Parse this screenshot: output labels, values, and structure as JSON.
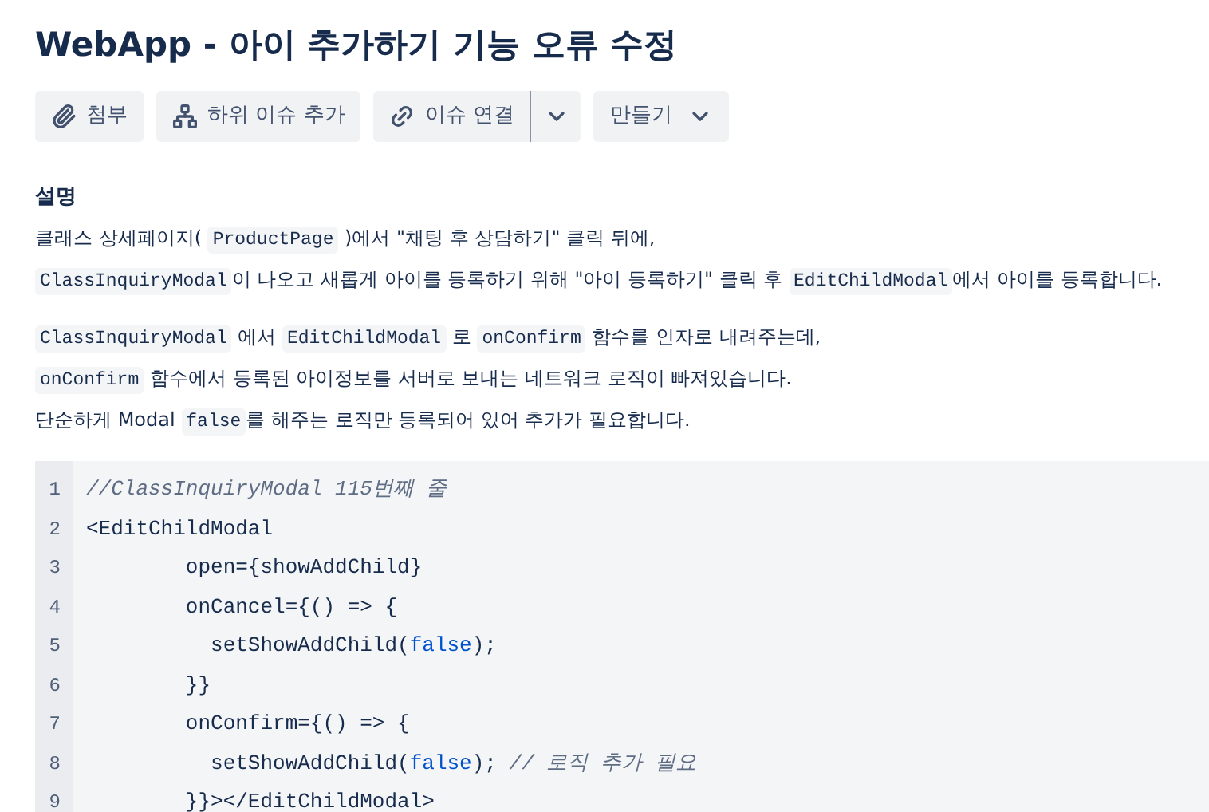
{
  "title": "WebApp - 아이 추가하기 기능 오류 수정",
  "toolbar": [
    {
      "kind": "attach",
      "label": "첨부"
    },
    {
      "kind": "subtask",
      "label": "하위 이슈 추가"
    },
    {
      "kind": "link",
      "label": "이슈 연결",
      "dropdown": true
    },
    {
      "kind": "create",
      "label": "만들기"
    }
  ],
  "description": {
    "heading": "설명",
    "paragraphs": [
      [
        [
          {
            "kind": "text",
            "text": "클래스 상세페이지( "
          },
          {
            "kind": "code",
            "text": "ProductPage"
          },
          {
            "kind": "text",
            "text": " )에서 \"채팅 후 상담하기\" 클릭 뒤에,"
          }
        ],
        [
          {
            "kind": "code",
            "text": "ClassInquiryModal"
          },
          {
            "kind": "text",
            "text": "이 나오고 새롭게 아이를 등록하기 위해 \"아이 등록하기\" 클릭 후 "
          },
          {
            "kind": "code",
            "text": "EditChildModal"
          },
          {
            "kind": "text",
            "text": "에서 아이를 등록합니다."
          }
        ]
      ],
      [
        [
          {
            "kind": "code",
            "text": "ClassInquiryModal"
          },
          {
            "kind": "text",
            "text": " 에서 "
          },
          {
            "kind": "code",
            "text": "EditChildModal"
          },
          {
            "kind": "text",
            "text": " 로 "
          },
          {
            "kind": "code",
            "text": "onConfirm"
          },
          {
            "kind": "text",
            "text": " 함수를 인자로 내려주는데,"
          }
        ],
        [
          {
            "kind": "code",
            "text": "onConfirm"
          },
          {
            "kind": "text",
            "text": " 함수에서 등록된 아이정보를 서버로 보내는 네트워크 로직이 빠져있습니다."
          }
        ],
        [
          {
            "kind": "text",
            "text": "단순하게 Modal "
          },
          {
            "kind": "code",
            "text": "false"
          },
          {
            "kind": "text",
            "text": "를 해주는 로직만 등록되어 있어 추가가 필요합니다."
          }
        ]
      ]
    ]
  },
  "code_block": {
    "lines": [
      {
        "number": "1",
        "tokens": [
          {
            "kind": "comment",
            "text": "//ClassInquiryModal 115번째 줄"
          }
        ]
      },
      {
        "number": "2",
        "tokens": [
          {
            "kind": "plain",
            "text": "<EditChildModal"
          }
        ]
      },
      {
        "number": "3",
        "tokens": [
          {
            "kind": "plain",
            "text": "        open={showAddChild}"
          }
        ]
      },
      {
        "number": "4",
        "tokens": [
          {
            "kind": "plain",
            "text": "        onCancel={() => {"
          }
        ]
      },
      {
        "number": "5",
        "tokens": [
          {
            "kind": "plain",
            "text": "          setShowAddChild("
          },
          {
            "kind": "keyword",
            "text": "false"
          },
          {
            "kind": "plain",
            "text": ");"
          }
        ]
      },
      {
        "number": "6",
        "tokens": [
          {
            "kind": "plain",
            "text": "        }}"
          }
        ]
      },
      {
        "number": "7",
        "tokens": [
          {
            "kind": "plain",
            "text": "        onConfirm={() => {"
          }
        ]
      },
      {
        "number": "8",
        "tokens": [
          {
            "kind": "plain",
            "text": "          setShowAddChild("
          },
          {
            "kind": "keyword",
            "text": "false"
          },
          {
            "kind": "plain",
            "text": "); "
          },
          {
            "kind": "comment",
            "text": "// 로직 추가 필요"
          }
        ]
      },
      {
        "number": "9",
        "tokens": [
          {
            "kind": "plain",
            "text": "        }}></EditChildModal>"
          }
        ]
      }
    ]
  }
}
